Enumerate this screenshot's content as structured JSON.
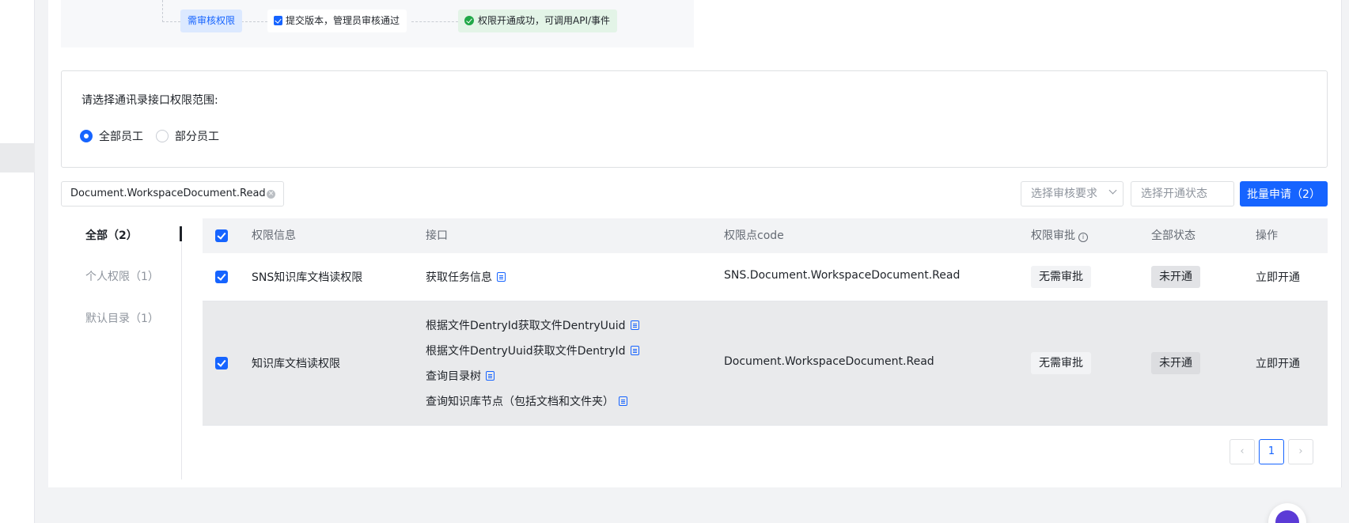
{
  "flow": {
    "step1": "需审核权限",
    "step2": "提交版本，管理员审核通过",
    "step3": "权限开通成功，可调用API/事件"
  },
  "scope": {
    "question": "请选择通讯录接口权限范围:",
    "options": [
      {
        "label": "全部员工",
        "selected": true
      },
      {
        "label": "部分员工",
        "selected": false
      }
    ]
  },
  "filters": {
    "search_tag": "Document.WorkspaceDocument.Read",
    "review_placeholder": "选择审核要求",
    "status_placeholder": "选择开通状态",
    "batch_button": "批量申请（2）"
  },
  "categories": [
    {
      "label": "全部（2）",
      "active": true
    },
    {
      "label": "个人权限（1）",
      "active": false
    },
    {
      "label": "默认目录（1）",
      "active": false
    }
  ],
  "table": {
    "headers": {
      "info": "权限信息",
      "api": "接口",
      "code": "权限点code",
      "approval": "权限审批",
      "status": "全部状态",
      "action": "操作"
    },
    "rows": [
      {
        "checked": true,
        "info": "SNS知识库文档读权限",
        "apis": [
          "获取任务信息"
        ],
        "code": "SNS.Document.WorkspaceDocument.Read",
        "approval": "无需审批",
        "status": "未开通",
        "action": "立即开通"
      },
      {
        "checked": true,
        "info": "知识库文档读权限",
        "apis": [
          "根据文件DentryId获取文件DentryUuid",
          "根据文件DentryUuid获取文件DentryId",
          "查询目录树",
          "查询知识库节点（包括文档和文件夹）"
        ],
        "code": "Document.WorkspaceDocument.Read",
        "approval": "无需审批",
        "status": "未开通",
        "action": "立即开通"
      }
    ]
  },
  "pagination": {
    "prev": "‹",
    "current": "1",
    "next": "›"
  },
  "colors": {
    "primary": "#1664ff",
    "success": "#20a848"
  }
}
